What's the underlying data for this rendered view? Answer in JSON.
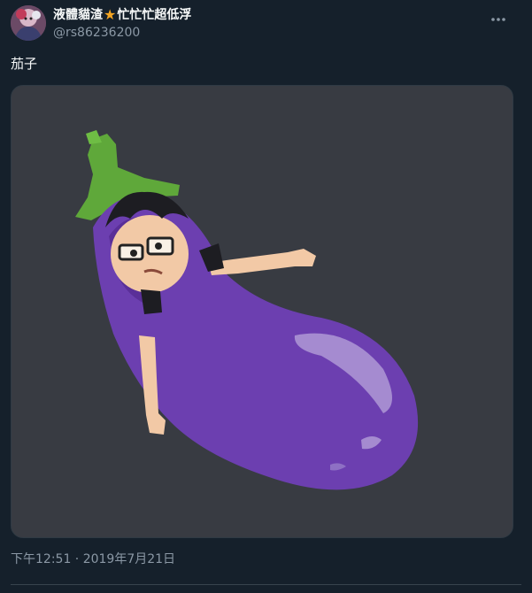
{
  "author": {
    "display_name_part1": "液體貓渣",
    "display_name_star": "★",
    "display_name_part2": "忙忙忙超低浮",
    "handle": "@rs86236200"
  },
  "tweet": {
    "text": "茄子",
    "timestamp": "下午12:51 · 2019年7月21日"
  },
  "icons": {
    "more": "more-dots-icon",
    "avatar": "avatar"
  },
  "colors": {
    "background": "#15202b",
    "text_primary": "#f7f9f9",
    "text_secondary": "#8b98a5",
    "media_background": "#383b42",
    "eggplant_purple": "#6c3fb0",
    "leaf_green": "#5fa83a",
    "star": "#f5a623"
  }
}
